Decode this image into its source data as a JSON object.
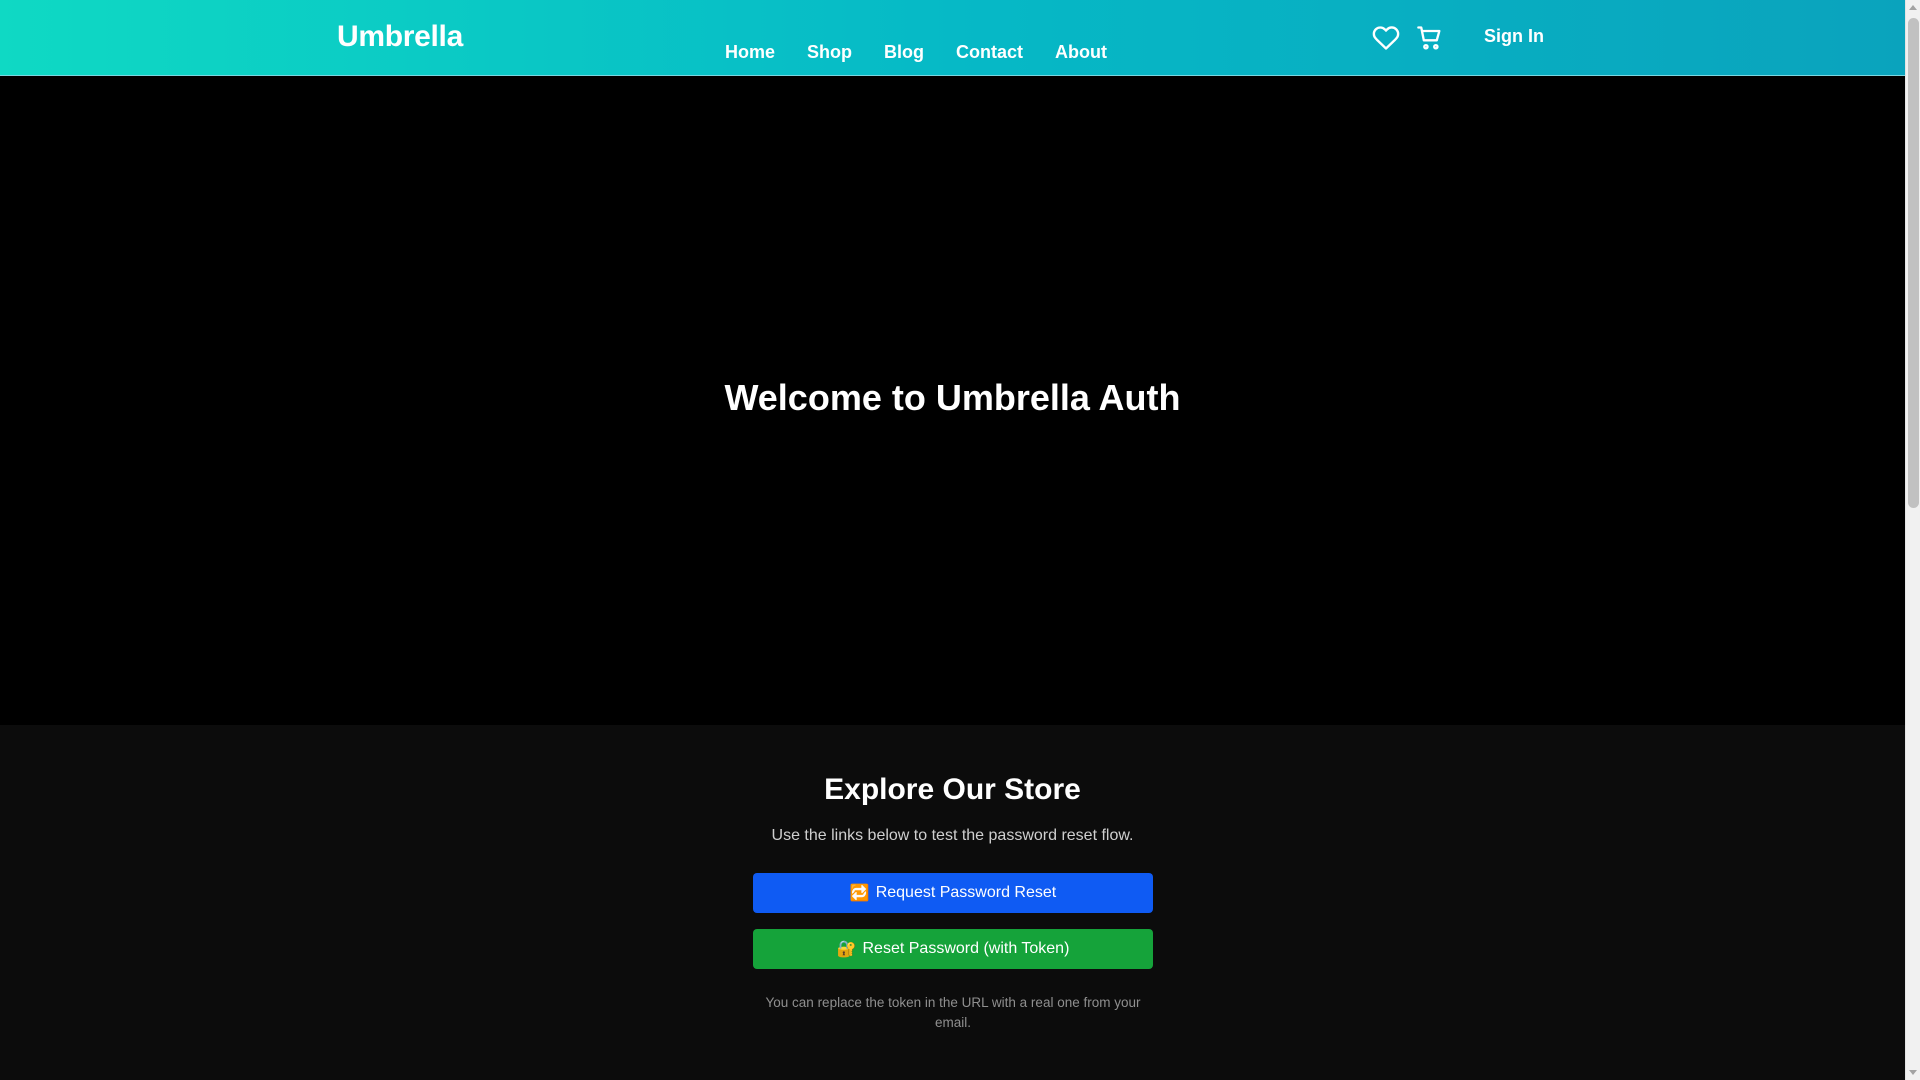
{
  "header": {
    "brand": "Umbrella",
    "nav": [
      {
        "label": "Home"
      },
      {
        "label": "Shop"
      },
      {
        "label": "Blog"
      },
      {
        "label": "Contact"
      },
      {
        "label": "About"
      }
    ],
    "icons": {
      "wishlist": "heart-icon",
      "cart": "cart-icon"
    },
    "sign_in_label": "Sign In",
    "gradient": [
      "#0fd9c4",
      "#06b9c6",
      "#0aa3bd"
    ]
  },
  "hero": {
    "title": "Welcome to Umbrella Auth",
    "background": "#000000"
  },
  "store": {
    "title": "Explore Our Store",
    "subtitle": "Use the links below to test the password reset flow.",
    "buttons": {
      "request": {
        "emoji": "🔁",
        "label": "Request Password Reset",
        "color": "#0f5bf3"
      },
      "reset": {
        "emoji": "🔐",
        "label": "Reset Password (with Token)",
        "color": "#15a33a"
      }
    },
    "note": "You can replace the token in the URL with a real one from your email."
  }
}
